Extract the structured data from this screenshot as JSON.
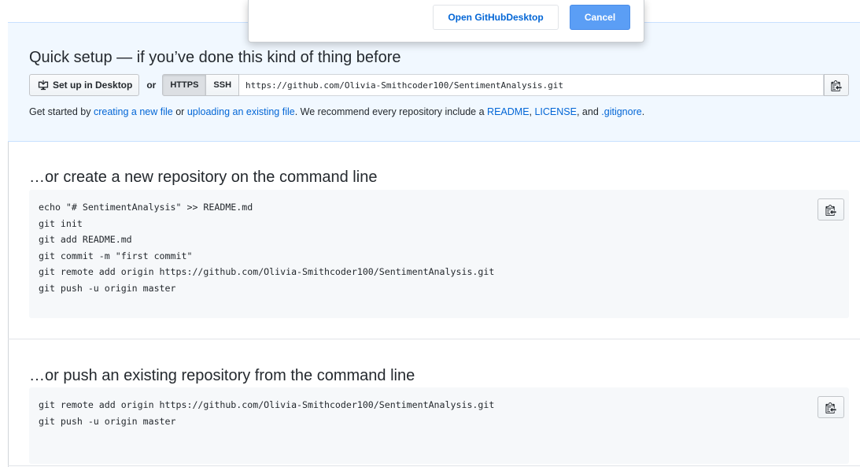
{
  "modal": {
    "open_label": "Open GitHubDesktop",
    "cancel_label": "Cancel"
  },
  "quick_setup": {
    "title": "Quick setup — if you’ve done this kind of thing before",
    "desktop_button": "Set up in Desktop",
    "or_text": "or",
    "https_label": "HTTPS",
    "ssh_label": "SSH",
    "url": "https://github.com/Olivia-Smithcoder100/SentimentAnalysis.git",
    "help": {
      "prefix": "Get started by ",
      "link_new_file": "creating a new file",
      "or": " or ",
      "link_upload": "uploading an existing file",
      "middle": ". We recommend every repository include a ",
      "link_readme": "README",
      "comma1": ", ",
      "link_license": "LICENSE",
      "and": ", and ",
      "link_gitignore": ".gitignore",
      "suffix": "."
    }
  },
  "new_repo": {
    "title": "…or create a new repository on the command line",
    "code": "echo \"# SentimentAnalysis\" >> README.md\ngit init\ngit add README.md\ngit commit -m \"first commit\"\ngit remote add origin https://github.com/Olivia-Smithcoder100/SentimentAnalysis.git\ngit push -u origin master"
  },
  "existing_repo": {
    "title": "…or push an existing repository from the command line",
    "code": "git remote add origin https://github.com/Olivia-Smithcoder100/SentimentAnalysis.git\ngit push -u origin master"
  },
  "icons": {
    "desktop": "desktop-download-icon",
    "copy": "clippy-icon"
  }
}
